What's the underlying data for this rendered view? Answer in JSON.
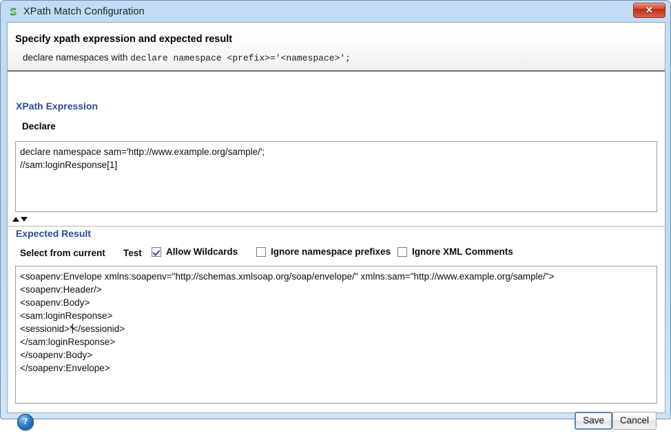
{
  "window": {
    "title": "XPath Match Configuration",
    "app_icon": "soapui-s-icon",
    "close_label": "✕"
  },
  "banner": {
    "title": "Specify xpath expression and expected result",
    "sub_prefix": "declare namespaces with ",
    "sub_mono": "declare namespace <prefix>='<namespace>';"
  },
  "xpath_section": {
    "heading": "XPath Expression",
    "declare_label": "Declare",
    "expression_value": "declare namespace sam='http://www.example.org/sample/';\n//sam:loginResponse[1]"
  },
  "splitter": {
    "up_icon": "triangle-up-icon",
    "down_icon": "triangle-down-icon"
  },
  "expected_section": {
    "heading": "Expected Result",
    "select_from_current_label": "Select from current",
    "test_label": "Test",
    "checkboxes": [
      {
        "label": "Allow Wildcards",
        "checked": true
      },
      {
        "label": "Ignore namespace prefixes",
        "checked": false
      },
      {
        "label": "Ignore XML Comments",
        "checked": false
      }
    ],
    "result_lines_before_cursor": "<soapenv:Envelope xmlns:soapenv=\"http://schemas.xmlsoap.org/soap/envelope/\" xmlns:sam=\"http://www.example.org/sample/\">\n<soapenv:Header/>\n<soapenv:Body>\n<sam:loginResponse>\n<sessionid>*",
    "result_lines_after_cursor": "</sessionid>\n</sam:loginResponse>\n</soapenv:Body>\n</soapenv:Envelope>"
  },
  "footer": {
    "help_icon": "help-question-icon",
    "help_glyph": "?",
    "save_label": "Save",
    "cancel_label": "Cancel"
  },
  "colors": {
    "titlebar": "#bfdaf3",
    "heading": "#2a4b8d",
    "close_button": "#c23a22",
    "help_blue": "#2e80c8",
    "focus_border": "#5a85bd"
  }
}
